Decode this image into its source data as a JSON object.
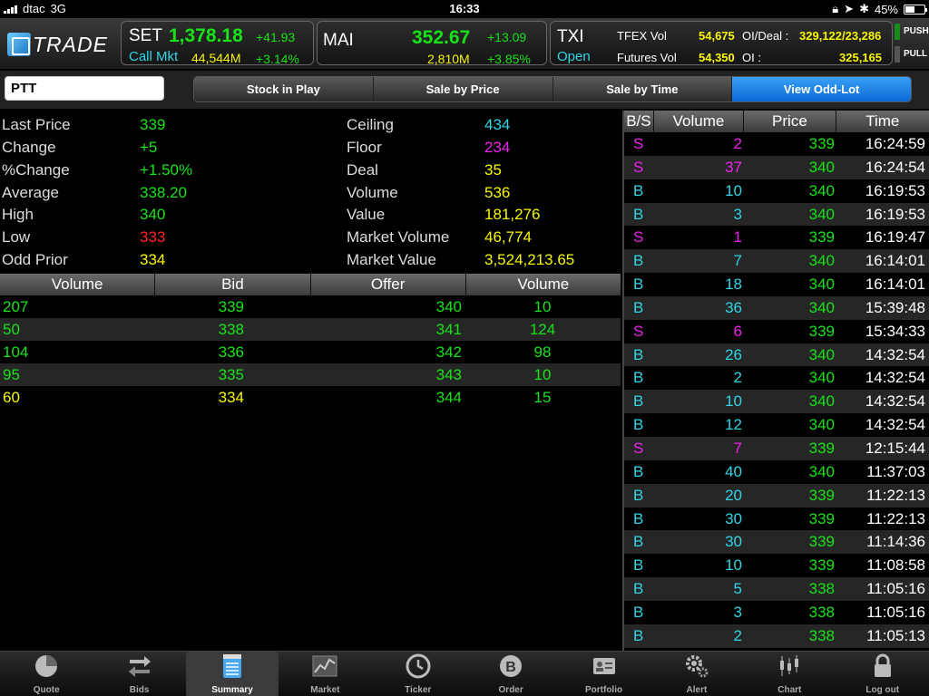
{
  "status_bar": {
    "carrier": "dtac",
    "network": "3G",
    "time": "16:33",
    "battery": "45%"
  },
  "header": {
    "logo_text": "TRADE",
    "set": {
      "name": "SET",
      "index": "1,378.18",
      "change": "+41.93",
      "sub_label": "Call Mkt",
      "value": "44,544M",
      "pct": "+3.14%"
    },
    "mai": {
      "name": "MAI",
      "index": "352.67",
      "change": "+13.09",
      "value": "2,810M",
      "pct": "+3.85%"
    },
    "txi": {
      "name": "TXI",
      "status": "Open",
      "tfex_vol_label": "TFEX Vol",
      "tfex_vol": "54,675",
      "oi_deal_label": "OI/Deal :",
      "oi_deal": "329,122/23,286",
      "futures_vol_label": "Futures Vol",
      "futures_vol": "54,350",
      "oi_label": "OI :",
      "oi": "325,165"
    },
    "push_label": "PUSH",
    "pull_label": "PULL"
  },
  "search": {
    "symbol": "PTT"
  },
  "tabs": [
    "Stock in Play",
    "Sale by Price",
    "Sale by Time",
    "View Odd-Lot"
  ],
  "info": {
    "left": [
      {
        "label": "Last Price",
        "value": "339",
        "color": "green"
      },
      {
        "label": "Change",
        "value": "+5",
        "color": "green"
      },
      {
        "label": "%Change",
        "value": "+1.50%",
        "color": "green"
      },
      {
        "label": "Average",
        "value": "338.20",
        "color": "green"
      },
      {
        "label": "High",
        "value": "340",
        "color": "green"
      },
      {
        "label": "Low",
        "value": "333",
        "color": "red"
      },
      {
        "label": "Odd Prior",
        "value": "334",
        "color": "yellow"
      }
    ],
    "right": [
      {
        "label": "Ceiling",
        "value": "434",
        "color": "cyan"
      },
      {
        "label": "Floor",
        "value": "234",
        "color": "magenta"
      },
      {
        "label": "Deal",
        "value": "35",
        "color": "yellow"
      },
      {
        "label": "Volume",
        "value": "536",
        "color": "yellow"
      },
      {
        "label": "Value",
        "value": "181,276",
        "color": "yellow"
      },
      {
        "label": "Market Volume",
        "value": "46,774",
        "color": "yellow"
      },
      {
        "label": "Market Value",
        "value": "3,524,213.65",
        "color": "yellow"
      }
    ]
  },
  "bid_offer": {
    "headers": [
      "Volume",
      "Bid",
      "Offer",
      "Volume"
    ],
    "rows": [
      {
        "bid_vol": "207",
        "bid": "339",
        "offer": "340",
        "offer_vol": "10",
        "bid_color": "green",
        "offer_color": "green"
      },
      {
        "bid_vol": "50",
        "bid": "338",
        "offer": "341",
        "offer_vol": "124",
        "bid_color": "green",
        "offer_color": "green"
      },
      {
        "bid_vol": "104",
        "bid": "336",
        "offer": "342",
        "offer_vol": "98",
        "bid_color": "green",
        "offer_color": "green"
      },
      {
        "bid_vol": "95",
        "bid": "335",
        "offer": "343",
        "offer_vol": "10",
        "bid_color": "green",
        "offer_color": "green"
      },
      {
        "bid_vol": "60",
        "bid": "334",
        "offer": "344",
        "offer_vol": "15",
        "bid_color": "yellow",
        "offer_color": "green"
      }
    ]
  },
  "ticker": {
    "headers": [
      "B/S",
      "Volume",
      "Price",
      "Time"
    ],
    "rows": [
      {
        "side": "S",
        "volume": "2",
        "price": "339",
        "time": "16:24:59"
      },
      {
        "side": "S",
        "volume": "37",
        "price": "340",
        "time": "16:24:54"
      },
      {
        "side": "B",
        "volume": "10",
        "price": "340",
        "time": "16:19:53"
      },
      {
        "side": "B",
        "volume": "3",
        "price": "340",
        "time": "16:19:53"
      },
      {
        "side": "S",
        "volume": "1",
        "price": "339",
        "time": "16:19:47"
      },
      {
        "side": "B",
        "volume": "7",
        "price": "340",
        "time": "16:14:01"
      },
      {
        "side": "B",
        "volume": "18",
        "price": "340",
        "time": "16:14:01"
      },
      {
        "side": "B",
        "volume": "36",
        "price": "340",
        "time": "15:39:48"
      },
      {
        "side": "S",
        "volume": "6",
        "price": "339",
        "time": "15:34:33"
      },
      {
        "side": "B",
        "volume": "26",
        "price": "340",
        "time": "14:32:54"
      },
      {
        "side": "B",
        "volume": "2",
        "price": "340",
        "time": "14:32:54"
      },
      {
        "side": "B",
        "volume": "10",
        "price": "340",
        "time": "14:32:54"
      },
      {
        "side": "B",
        "volume": "12",
        "price": "340",
        "time": "14:32:54"
      },
      {
        "side": "S",
        "volume": "7",
        "price": "339",
        "time": "12:15:44"
      },
      {
        "side": "B",
        "volume": "40",
        "price": "340",
        "time": "11:37:03"
      },
      {
        "side": "B",
        "volume": "20",
        "price": "339",
        "time": "11:22:13"
      },
      {
        "side": "B",
        "volume": "30",
        "price": "339",
        "time": "11:22:13"
      },
      {
        "side": "B",
        "volume": "30",
        "price": "339",
        "time": "11:14:36"
      },
      {
        "side": "B",
        "volume": "10",
        "price": "339",
        "time": "11:08:58"
      },
      {
        "side": "B",
        "volume": "5",
        "price": "338",
        "time": "11:05:16"
      },
      {
        "side": "B",
        "volume": "3",
        "price": "338",
        "time": "11:05:16"
      },
      {
        "side": "B",
        "volume": "2",
        "price": "338",
        "time": "11:05:13"
      }
    ]
  },
  "tabbar": [
    {
      "label": "Quote",
      "icon": "pie-chart-icon"
    },
    {
      "label": "Bids",
      "icon": "arrows-icon"
    },
    {
      "label": "Summary",
      "icon": "notepad-icon",
      "active": true
    },
    {
      "label": "Market",
      "icon": "line-chart-icon"
    },
    {
      "label": "Ticker",
      "icon": "clock-icon"
    },
    {
      "label": "Order",
      "icon": "coin-icon"
    },
    {
      "label": "Portfolio",
      "icon": "id-card-icon"
    },
    {
      "label": "Alert",
      "icon": "gears-icon"
    },
    {
      "label": "Chart",
      "icon": "candlestick-icon"
    },
    {
      "label": "Log out",
      "icon": "lock-icon"
    }
  ]
}
